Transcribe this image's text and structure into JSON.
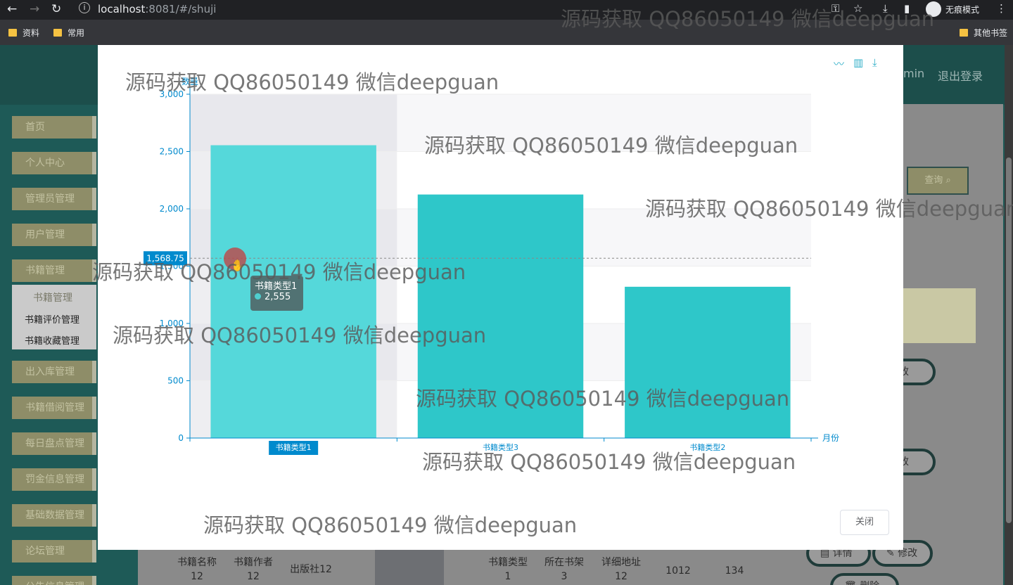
{
  "browser": {
    "url_host": "localhost",
    "url_rest": ":8081/#/shuji",
    "profile_label": "无痕模式",
    "bookmarks": [
      "资料",
      "常用"
    ],
    "other_bookmarks": "其他书签"
  },
  "header": {
    "user_partial": "min",
    "logout": "退出登录"
  },
  "sidebar": {
    "items": [
      "首页",
      "个人中心",
      "管理员管理",
      "用户管理",
      "书籍管理",
      "出入库管理",
      "书籍借阅管理",
      "每日盘点管理",
      "罚金信息管理",
      "基础数据管理",
      "论坛管理",
      "公告信息管理"
    ],
    "submenu_title": "书籍管理",
    "submenu_items": [
      "书籍评价管理",
      "书籍收藏管理"
    ]
  },
  "main": {
    "search_label": "查询",
    "modify_label": "修改",
    "detail_label": "详情",
    "delete_label": "删除",
    "row": {
      "name_label": "书籍名称",
      "name_val": "12",
      "author_label": "书籍作者",
      "author_val": "12",
      "publisher": "出版社12",
      "type_label": "书籍类型",
      "type_val": "1",
      "shelf_label": "所在书架",
      "shelf_val": "3",
      "address_label": "详细地址",
      "address_val": "12",
      "num1": "1012",
      "num2": "134"
    }
  },
  "modal": {
    "close_label": "关闭",
    "toolbox": [
      "line-chart-icon",
      "bar-chart-icon",
      "download-icon"
    ]
  },
  "chart_data": {
    "type": "bar",
    "categories": [
      "书籍类型1",
      "书籍类型3",
      "书籍类型2"
    ],
    "values": [
      2555,
      2125,
      1320
    ],
    "ylabel": "数量",
    "xlabel": "月份",
    "ylim": [
      0,
      3000
    ],
    "yticks": [
      "0",
      "500",
      "1,000",
      "1,500",
      "2,000",
      "2,500",
      "3,000"
    ],
    "axis_pointer_label": "1,568.75",
    "axis_pointer_value": 1568.75,
    "highlighted_category": "书籍类型1",
    "tooltip": {
      "title": "书籍类型1",
      "value": "2,555"
    },
    "colors": {
      "bar": "#2ec7c9",
      "bar_hover": "#55d8da",
      "axis": "#008acd"
    }
  },
  "watermark": "源码获取 QQ86050149 微信deepguan"
}
